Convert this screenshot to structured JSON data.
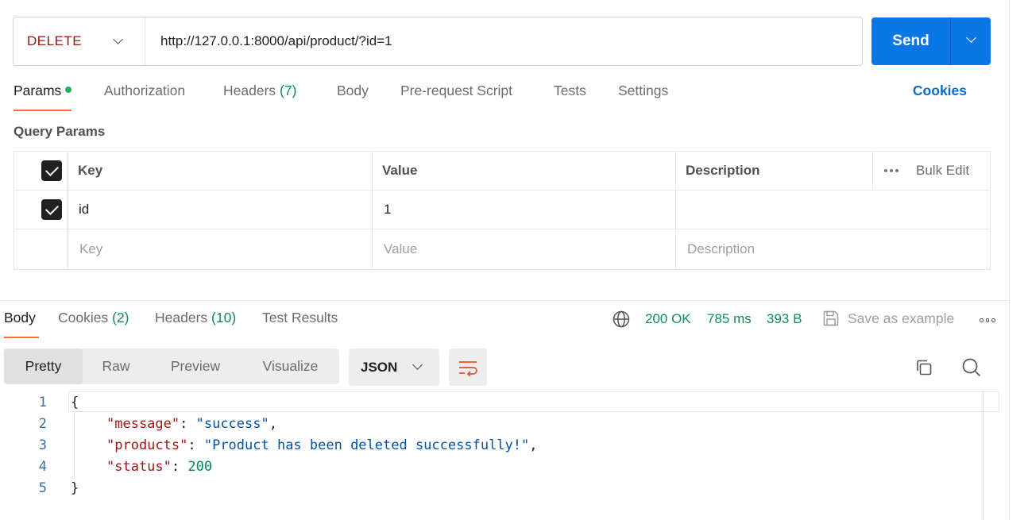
{
  "request": {
    "method": "DELETE",
    "url": "http://127.0.0.1:8000/api/product/?id=1",
    "send_label": "Send"
  },
  "request_tabs": {
    "params": "Params",
    "authorization": "Authorization",
    "headers": "Headers",
    "headers_count": "(7)",
    "body": "Body",
    "pre_request": "Pre-request Script",
    "tests": "Tests",
    "settings": "Settings",
    "cookies": "Cookies"
  },
  "query_params": {
    "title": "Query Params",
    "columns": {
      "key": "Key",
      "value": "Value",
      "description": "Description"
    },
    "bulk_edit": "Bulk Edit",
    "rows": [
      {
        "checked": true,
        "key": "id",
        "value": "1",
        "description": ""
      }
    ],
    "placeholders": {
      "key": "Key",
      "value": "Value",
      "description": "Description"
    }
  },
  "response_tabs": {
    "body": "Body",
    "cookies": "Cookies",
    "cookies_count": "(2)",
    "headers": "Headers",
    "headers_count": "(10)",
    "test_results": "Test Results"
  },
  "response_status": {
    "status": "200 OK",
    "time": "785 ms",
    "size": "393 B",
    "save_example": "Save as example"
  },
  "view": {
    "modes": [
      "Pretty",
      "Raw",
      "Preview",
      "Visualize"
    ],
    "active_mode": "Pretty",
    "format": "JSON"
  },
  "response_body": {
    "line_numbers": [
      "1",
      "2",
      "3",
      "4",
      "5"
    ],
    "open_brace": "{",
    "close_brace": "}",
    "fields": [
      {
        "key": "\"message\"",
        "value": "\"success\"",
        "comma": ","
      },
      {
        "key": "\"products\"",
        "value": "\"Product has been deleted successfully!\"",
        "comma": ","
      },
      {
        "key": "\"status\"",
        "value": "200",
        "comma": ""
      }
    ]
  },
  "colors": {
    "method": "#8e1a10",
    "send": "#0b76e6",
    "accent": "#f26b3a",
    "status_green": "#0f8f4e",
    "link_blue": "#0b6bcb"
  }
}
